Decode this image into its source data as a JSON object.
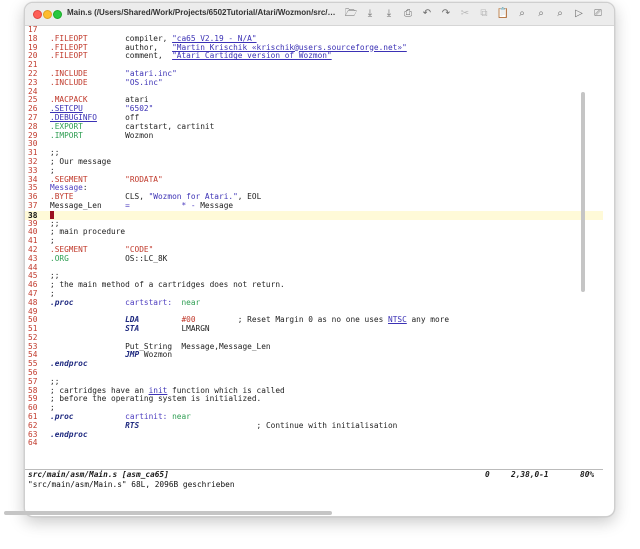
{
  "window": {
    "title": "Main.s (/Users/Shared/Work/Projects/6502Tutorial/Atari/Wozmon/src/main/as..."
  },
  "toolbar": {
    "buttons": [
      {
        "name": "open-icon",
        "glyph": "🗁"
      },
      {
        "name": "save-icon",
        "glyph": "⤓"
      },
      {
        "name": "save-all-icon",
        "glyph": "⤓"
      },
      {
        "name": "print-icon",
        "glyph": "⎙"
      },
      {
        "name": "undo-icon",
        "glyph": "↶"
      },
      {
        "name": "redo-icon",
        "glyph": "↷"
      },
      {
        "name": "cut-icon",
        "glyph": "✂"
      },
      {
        "name": "copy-icon",
        "glyph": "⧉"
      },
      {
        "name": "paste-icon",
        "glyph": "📋"
      },
      {
        "name": "find-icon",
        "glyph": "⌕"
      },
      {
        "name": "find-next-icon",
        "glyph": "⌕"
      },
      {
        "name": "find-prev-icon",
        "glyph": "⌕"
      },
      {
        "name": "run-icon",
        "glyph": "▷"
      },
      {
        "name": "script-icon",
        "glyph": "⎚"
      },
      {
        "name": "help-icon",
        "glyph": "?"
      }
    ]
  },
  "editor": {
    "current_line": "38",
    "lines": [
      {
        "n": "17",
        "segs": []
      },
      {
        "n": "18",
        "segs": [
          {
            "t": ".FILEOPT",
            "c": "kw"
          },
          {
            "t": "        compiler, "
          },
          {
            "t": "\"ca65 V2.19 - N/A\"",
            "c": "link"
          }
        ]
      },
      {
        "n": "19",
        "segs": [
          {
            "t": ".FILEOPT",
            "c": "kw"
          },
          {
            "t": "        author,   "
          },
          {
            "t": "\"Martin Krischik «krischik@users.sourceforge.net»\"",
            "c": "link"
          }
        ]
      },
      {
        "n": "20",
        "segs": [
          {
            "t": ".FILEOPT",
            "c": "kw"
          },
          {
            "t": "        comment,  "
          },
          {
            "t": "\"Atari Cartidge version of Wozmon\"",
            "c": "link"
          }
        ]
      },
      {
        "n": "21",
        "segs": []
      },
      {
        "n": "22",
        "segs": [
          {
            "t": ".INCLUDE",
            "c": "kw"
          },
          {
            "t": "        "
          },
          {
            "t": "\"atari.inc\"",
            "c": "str"
          }
        ]
      },
      {
        "n": "23",
        "segs": [
          {
            "t": ".INCLUDE",
            "c": "kw"
          },
          {
            "t": "        "
          },
          {
            "t": "\"OS.inc\"",
            "c": "str"
          }
        ]
      },
      {
        "n": "24",
        "segs": []
      },
      {
        "n": "25",
        "segs": [
          {
            "t": ".MACPACK",
            "c": "kw"
          },
          {
            "t": "        atari"
          }
        ]
      },
      {
        "n": "26",
        "segs": [
          {
            "t": ".SETCPU",
            "c": "link"
          },
          {
            "t": "         "
          },
          {
            "t": "\"6502\"",
            "c": "str"
          }
        ]
      },
      {
        "n": "27",
        "segs": [
          {
            "t": ".DEBUGINFO",
            "c": "link"
          },
          {
            "t": "      off"
          }
        ]
      },
      {
        "n": "28",
        "segs": [
          {
            "t": ".EXPORT",
            "c": "green"
          },
          {
            "t": "         cartstart, cartinit"
          }
        ]
      },
      {
        "n": "29",
        "segs": [
          {
            "t": ".IMPORT",
            "c": "green"
          },
          {
            "t": "         Wozmon"
          }
        ]
      },
      {
        "n": "30",
        "segs": []
      },
      {
        "n": "31",
        "segs": [
          {
            "t": ";;"
          }
        ]
      },
      {
        "n": "32",
        "segs": [
          {
            "t": "; Our message"
          }
        ]
      },
      {
        "n": "33",
        "segs": [
          {
            "t": ";"
          }
        ]
      },
      {
        "n": "34",
        "segs": [
          {
            "t": ".SEGMENT",
            "c": "kw"
          },
          {
            "t": "        "
          },
          {
            "t": "\"RODATA\"",
            "c": "kw"
          }
        ]
      },
      {
        "n": "35",
        "segs": [
          {
            "t": "Message",
            "c": "kwb"
          },
          {
            "t": ":"
          }
        ]
      },
      {
        "n": "36",
        "segs": [
          {
            "t": ".BYTE",
            "c": "kw"
          },
          {
            "t": "           CLS, "
          },
          {
            "t": "\"Wozmon for Atari.\"",
            "c": "str"
          },
          {
            "t": ", EOL"
          }
        ]
      },
      {
        "n": "37",
        "segs": [
          {
            "t": "Message_Len     "
          },
          {
            "t": "=",
            "c": "kwb"
          },
          {
            "t": "           "
          },
          {
            "t": "* - ",
            "c": "kwb"
          },
          {
            "t": "Message"
          }
        ]
      },
      {
        "n": "38",
        "segs": [],
        "cursor": true
      },
      {
        "n": "39",
        "segs": [
          {
            "t": ";;"
          }
        ]
      },
      {
        "n": "40",
        "segs": [
          {
            "t": "; main procedure"
          }
        ]
      },
      {
        "n": "41",
        "segs": [
          {
            "t": ";"
          }
        ]
      },
      {
        "n": "42",
        "segs": [
          {
            "t": ".SEGMENT",
            "c": "kw"
          },
          {
            "t": "        "
          },
          {
            "t": "\"CODE\"",
            "c": "kw"
          }
        ]
      },
      {
        "n": "43",
        "segs": [
          {
            "t": ".ORG",
            "c": "green"
          },
          {
            "t": "            OS::LC_8K"
          }
        ]
      },
      {
        "n": "44",
        "segs": []
      },
      {
        "n": "45",
        "segs": [
          {
            "t": ";;"
          }
        ]
      },
      {
        "n": "46",
        "segs": [
          {
            "t": "; the main method of a cartridges does not return."
          }
        ]
      },
      {
        "n": "47",
        "segs": [
          {
            "t": ";"
          }
        ]
      },
      {
        "n": "48",
        "segs": [
          {
            "t": ".proc",
            "c": "proc"
          },
          {
            "t": "           "
          },
          {
            "t": "cartstart:",
            "c": "kwb"
          },
          {
            "t": "  "
          },
          {
            "t": "near",
            "c": "green"
          }
        ]
      },
      {
        "n": "49",
        "segs": []
      },
      {
        "n": "50",
        "segs": [
          {
            "t": "                "
          },
          {
            "t": "LDA",
            "c": "bi"
          },
          {
            "t": "         "
          },
          {
            "t": "#00",
            "c": "kw"
          },
          {
            "t": "         ; Reset Margin 0 as no one uses "
          },
          {
            "t": "NTSC",
            "c": "link"
          },
          {
            "t": " any more"
          }
        ]
      },
      {
        "n": "51",
        "segs": [
          {
            "t": "                "
          },
          {
            "t": "STA",
            "c": "bi"
          },
          {
            "t": "         LMARGN"
          }
        ]
      },
      {
        "n": "52",
        "segs": []
      },
      {
        "n": "53",
        "segs": [
          {
            "t": "                Put_String  Message,Message_Len"
          }
        ]
      },
      {
        "n": "54",
        "segs": [
          {
            "t": "                "
          },
          {
            "t": "JMP",
            "c": "bi"
          },
          {
            "t": " Wozmon"
          }
        ]
      },
      {
        "n": "55",
        "segs": [
          {
            "t": ".endproc",
            "c": "proc"
          }
        ]
      },
      {
        "n": "56",
        "segs": []
      },
      {
        "n": "57",
        "segs": [
          {
            "t": ";;"
          }
        ]
      },
      {
        "n": "58",
        "segs": [
          {
            "t": "; cartridges have an "
          },
          {
            "t": "init",
            "c": "link"
          },
          {
            "t": " function which is called"
          }
        ]
      },
      {
        "n": "59",
        "segs": [
          {
            "t": "; before the operating system is initialized."
          }
        ]
      },
      {
        "n": "60",
        "segs": [
          {
            "t": ";"
          }
        ]
      },
      {
        "n": "61",
        "segs": [
          {
            "t": ".proc",
            "c": "proc"
          },
          {
            "t": "           "
          },
          {
            "t": "cartinit:",
            "c": "kwb"
          },
          {
            "t": " "
          },
          {
            "t": "near",
            "c": "green"
          }
        ]
      },
      {
        "n": "62",
        "segs": [
          {
            "t": "                "
          },
          {
            "t": "RTS",
            "c": "bi"
          },
          {
            "t": "                         ; Continue with initialisation"
          }
        ]
      },
      {
        "n": "63",
        "segs": [
          {
            "t": ".endproc",
            "c": "proc"
          }
        ]
      },
      {
        "n": "64",
        "segs": []
      }
    ]
  },
  "status": {
    "file": "src/main/asm/Main.s [asm_ca65]",
    "modified": "0",
    "position": "2,38,0-1",
    "percent": "80%"
  },
  "command_line": "\"src/main/asm/Main.s\" 68L, 2096B geschrieben"
}
